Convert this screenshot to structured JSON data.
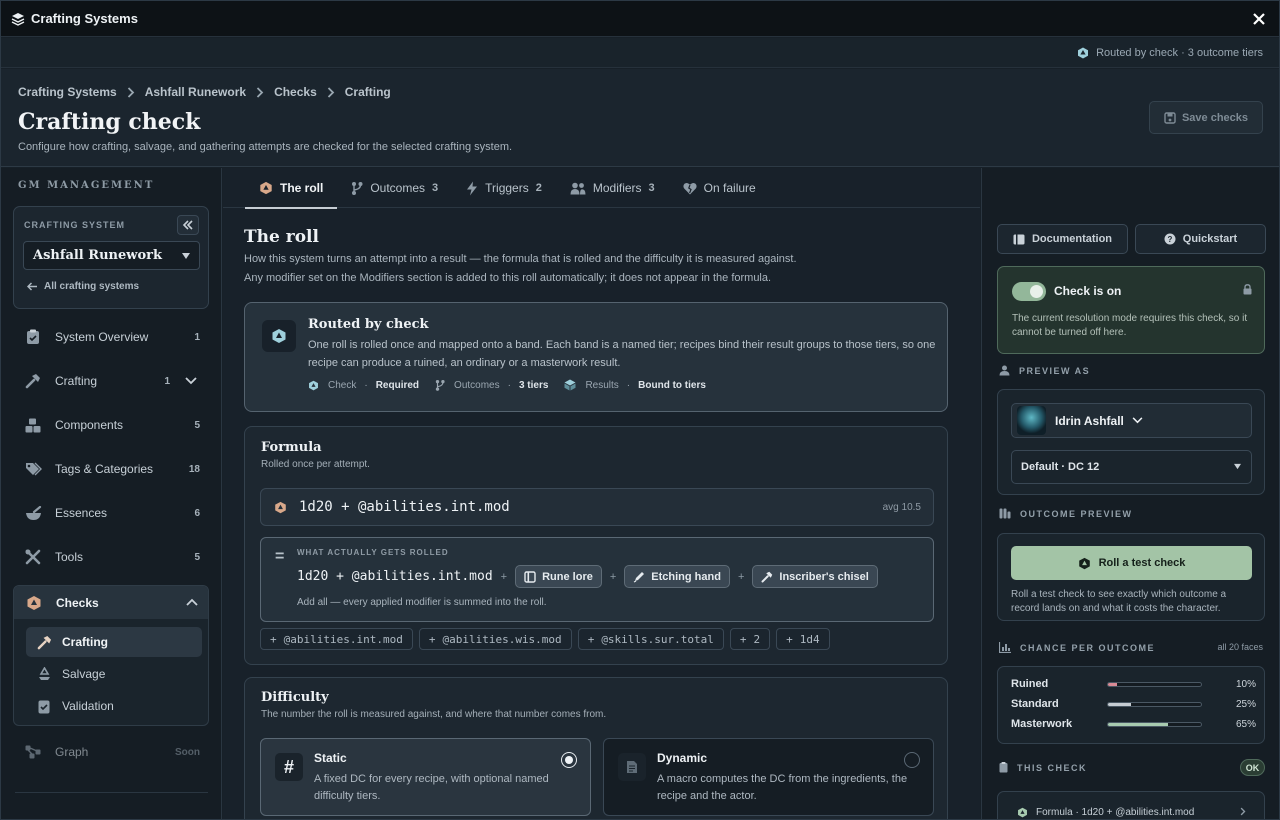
{
  "window": {
    "title": "Crafting Systems"
  },
  "statusbar": {
    "text": "Routed by check · 3 outcome tiers"
  },
  "breadcrumb": [
    "Crafting Systems",
    "Ashfall Runework",
    "Checks",
    "Crafting"
  ],
  "page": {
    "title": "Crafting check",
    "subtitle": "Configure how crafting, salvage, and gathering attempts are checked for the selected crafting system.",
    "save_label": "Save checks"
  },
  "sidebar": {
    "section_label": "GM MANAGEMENT",
    "system_label": "CRAFTING SYSTEM",
    "system_value": "Ashfall Runework",
    "all_systems": "All crafting systems",
    "items": [
      {
        "label": "System Overview",
        "count": "1",
        "icon": "clipboard-icon"
      },
      {
        "label": "Crafting",
        "count": "1",
        "icon": "hammer-icon"
      },
      {
        "label": "Components",
        "count": "5",
        "icon": "boxes-icon"
      },
      {
        "label": "Tags & Categories",
        "count": "18",
        "icon": "tags-icon"
      },
      {
        "label": "Essences",
        "count": "6",
        "icon": "mortar-icon"
      },
      {
        "label": "Tools",
        "count": "5",
        "icon": "tools-icon"
      }
    ],
    "checks": {
      "label": "Checks",
      "sub": [
        {
          "label": "Crafting",
          "icon": "hammer-icon"
        },
        {
          "label": "Salvage",
          "icon": "recycle-icon"
        },
        {
          "label": "Validation",
          "icon": "clipboard-check-icon"
        }
      ]
    },
    "graph": {
      "label": "Graph",
      "badge": "Soon"
    }
  },
  "tabs": [
    {
      "label": "The roll",
      "count": ""
    },
    {
      "label": "Outcomes",
      "count": "3"
    },
    {
      "label": "Triggers",
      "count": "2"
    },
    {
      "label": "Modifiers",
      "count": "3"
    },
    {
      "label": "On failure",
      "count": ""
    }
  ],
  "roll": {
    "title": "The roll",
    "desc1": "How this system turns an attempt into a result — the formula that is rolled and the difficulty it is measured against.",
    "desc2": "Any modifier set on the Modifiers section is added to this roll automatically; it does not appear in the formula."
  },
  "routed": {
    "title": "Routed by check",
    "desc": "One roll is rolled once and mapped onto a band. Each band is a named tier; recipes bind their result groups to those tiers, so one recipe can produce a ruined, an ordinary or a masterwork result.",
    "check_label": "Check",
    "check_value": "Required",
    "outcomes_label": "Outcomes",
    "outcomes_value": "3 tiers",
    "results_label": "Results",
    "results_value": "Bound to tiers"
  },
  "formula": {
    "title": "Formula",
    "sub": "Rolled once per attempt.",
    "expr": "1d20 + @abilities.int.mod",
    "avg": "avg 10.5",
    "rolled_label": "WHAT ACTUALLY GETS ROLLED",
    "rolled_expr": "1d20 + @abilities.int.mod",
    "chips": [
      "Rune lore",
      "Etching hand",
      "Inscriber's chisel"
    ],
    "rolled_foot": "Add all — every applied modifier is summed into the roll.",
    "suggestions": [
      "@abilities.int.mod",
      "@abilities.wis.mod",
      "@skills.sur.total",
      "2",
      "1d4"
    ]
  },
  "difficulty": {
    "title": "Difficulty",
    "sub": "The number the roll is measured against, and where that number comes from.",
    "static_title": "Static",
    "static_desc": "A fixed DC for every recipe, with optional named difficulty tiers.",
    "dynamic_title": "Dynamic",
    "dynamic_desc": "A macro computes the DC from the ingredients, the recipe and the actor."
  },
  "right": {
    "doc_label": "Documentation",
    "quick_label": "Quickstart",
    "check_on_title": "Check is on",
    "check_on_desc": "The current resolution mode requires this check, so it cannot be turned off here.",
    "preview_as_label": "PREVIEW AS",
    "actor_name": "Idrin Ashfall",
    "dc_value": "Default · DC 12",
    "outcome_preview_label": "OUTCOME PREVIEW",
    "roll_test_label": "Roll a test check",
    "roll_test_desc": "Roll a test check to see exactly which outcome a record lands on and what it costs the character.",
    "chance_label": "CHANCE PER OUTCOME",
    "chance_note": "all 20 faces",
    "outcomes": [
      {
        "label": "Ruined",
        "pct": "10%",
        "value": 0.1,
        "color": "#d98b96"
      },
      {
        "label": "Standard",
        "pct": "25%",
        "value": 0.25,
        "color": "#c6cdd3"
      },
      {
        "label": "Masterwork",
        "pct": "65%",
        "value": 0.65,
        "color": "#a8cbb0"
      }
    ],
    "this_check_label": "THIS CHECK",
    "ok_badge": "OK",
    "formula_row": "Formula · 1d20 + @abilities.int.mod"
  }
}
